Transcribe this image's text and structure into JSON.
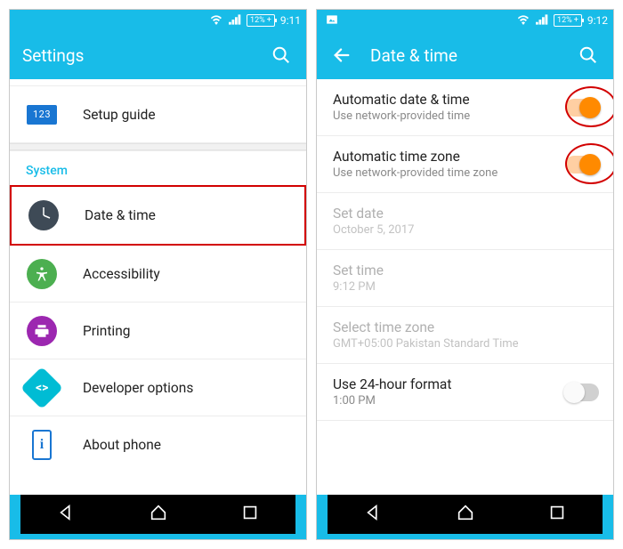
{
  "left": {
    "status": {
      "battery": "12%",
      "time": "9:11"
    },
    "appbar": {
      "title": "Settings"
    },
    "rows": {
      "setup": "Setup guide",
      "section": "System",
      "date_time": "Date & time",
      "accessibility": "Accessibility",
      "printing": "Printing",
      "dev": "Developer options",
      "about": "About phone"
    },
    "icons": {
      "setup_badge": "123"
    }
  },
  "right": {
    "status": {
      "battery": "12%",
      "time": "9:12"
    },
    "appbar": {
      "title": "Date & time"
    },
    "rows": {
      "auto_dt": {
        "title": "Automatic date & time",
        "sub": "Use network-provided time"
      },
      "auto_tz": {
        "title": "Automatic time zone",
        "sub": "Use network-provided time zone"
      },
      "set_date": {
        "title": "Set date",
        "sub": "October 5, 2017"
      },
      "set_time": {
        "title": "Set time",
        "sub": "9:12 PM"
      },
      "sel_tz": {
        "title": "Select time zone",
        "sub": "GMT+05:00 Pakistan Standard Time"
      },
      "fmt24": {
        "title": "Use 24-hour format",
        "sub": "1:00 PM"
      }
    }
  }
}
